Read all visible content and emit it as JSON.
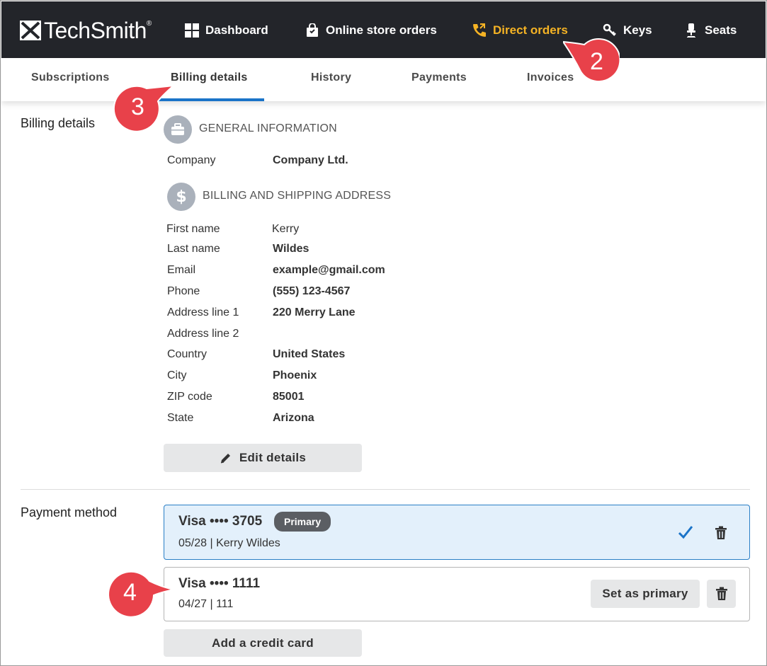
{
  "brand": {
    "name": "TechSmith",
    "reg": "®"
  },
  "nav": {
    "dashboard": "Dashboard",
    "online_store_orders": "Online store orders",
    "direct_orders": "Direct orders",
    "keys": "Keys",
    "seats": "Seats"
  },
  "tabs": {
    "subscriptions": "Subscriptions",
    "billing_details": "Billing details",
    "history": "History",
    "payments": "Payments",
    "invoices": "Invoices"
  },
  "billing": {
    "section_title": "Billing details",
    "general_info_title": "GENERAL INFORMATION",
    "company_label": "Company",
    "company_value": "Company Ltd.",
    "address_title": "BILLING AND SHIPPING ADDRESS",
    "fields": {
      "first_name_label": "First name",
      "first_name_value": "Kerry",
      "last_name_label": "Last name",
      "last_name_value": "Wildes",
      "email_label": "Email",
      "email_value": "example@gmail.com",
      "phone_label": "Phone",
      "phone_value": "(555) 123-4567",
      "address1_label": "Address line 1",
      "address1_value": "220 Merry Lane",
      "address2_label": "Address line 2",
      "address2_value": "",
      "country_label": "Country",
      "country_value": "United States",
      "city_label": "City",
      "city_value": "Phoenix",
      "zip_label": "ZIP code",
      "zip_value": "85001",
      "state_label": "State",
      "state_value": "Arizona"
    },
    "edit_button": "Edit details"
  },
  "payment": {
    "section_title": "Payment method",
    "cards": [
      {
        "title": "Visa •••• 3705",
        "badge": "Primary",
        "subtitle": "05/28 | Kerry Wildes"
      },
      {
        "title": "Visa •••• 1111",
        "subtitle": "04/27 | 111",
        "set_primary_label": "Set as primary"
      }
    ],
    "add_card_button": "Add a credit card"
  },
  "callouts": {
    "two": "2",
    "three": "3",
    "four": "4"
  },
  "colors": {
    "accent": "#f5b324",
    "topbar": "#23252a",
    "link_blue": "#1a73c8",
    "callout_red": "#e8414a"
  }
}
